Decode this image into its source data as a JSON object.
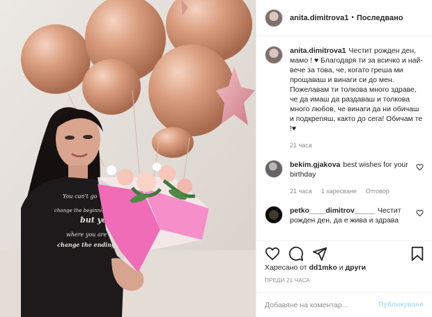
{
  "header": {
    "username": "anita.dimitrova1",
    "separator": "•",
    "follow_label": "Последвано"
  },
  "caption": {
    "username": "anita.dimitrova1",
    "text": "Честит рожден ден, мамо ! ♥ Благодаря ти за всичко и най-вече за това, че, когато греша ми прощаваш и винаги си до мен. Пожелавам ти толкова много здраве, че да имаш да раздаваш и толкова много любов, че винаги да ни обичаш и подкрепяш, както до сега! Обичам те !♥",
    "time": "21 часа"
  },
  "comments": [
    {
      "username": "bekim.gjakova",
      "text": "best wishes for your birthday",
      "time": "21 часа",
      "likes": "1 харесване",
      "reply": "Отговор"
    },
    {
      "username": "petko____dimitrov_____",
      "text": "Честит рожден ден, да е жива и здрава"
    }
  ],
  "likes": {
    "prefix": "Харесано от",
    "user": "dd1mko",
    "connector": "и",
    "others": "други"
  },
  "timestamp": "ПРЕДИ 21 ЧАСА",
  "add_comment": {
    "placeholder": "Добавяне на коментар...",
    "publish_label": "Публикуване"
  },
  "icons": {
    "like": "heart-icon",
    "comment": "comment-icon",
    "share": "share-icon",
    "save": "bookmark-icon"
  },
  "colors": {
    "balloon": "#D99D7E",
    "bouquet_wrap": "#F06CB7",
    "publish_disabled": "#B2DFFC"
  }
}
